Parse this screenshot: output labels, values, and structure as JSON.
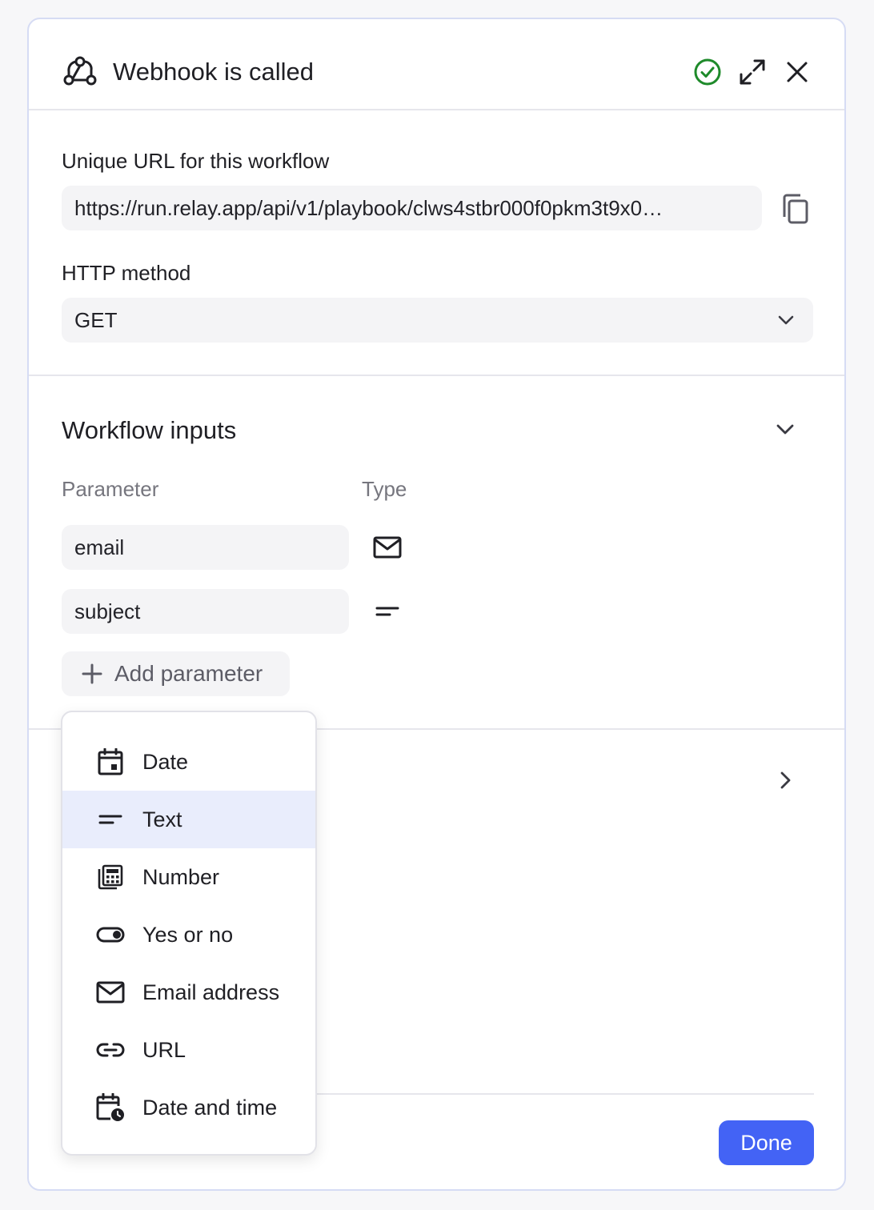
{
  "header": {
    "title": "Webhook is called",
    "icon": "webhook-icon",
    "status_icon": "check-circle-icon",
    "status_color": "#1e8a2a",
    "expand_icon": "expand-icon",
    "close_icon": "close-icon"
  },
  "url_section": {
    "label": "Unique URL for this workflow",
    "url_value": "https://run.relay.app/api/v1/playbook/clws4stbr000f0pkm3t9x0…",
    "copy_icon": "copy-icon"
  },
  "method_section": {
    "label": "HTTP method",
    "selected": "GET"
  },
  "inputs_section": {
    "title": "Workflow inputs",
    "columns": {
      "parameter": "Parameter",
      "type": "Type"
    },
    "params": [
      {
        "name": "email",
        "type_icon": "mail-icon"
      },
      {
        "name": "subject",
        "type_icon": "text-lines-icon"
      }
    ],
    "add_label": "Add parameter"
  },
  "type_menu": {
    "items": [
      {
        "label": "Date",
        "icon": "calendar-icon",
        "active": false
      },
      {
        "label": "Text",
        "icon": "text-lines-icon",
        "active": true
      },
      {
        "label": "Number",
        "icon": "calculator-icon",
        "active": false
      },
      {
        "label": "Yes or no",
        "icon": "toggle-icon",
        "active": false
      },
      {
        "label": "Email address",
        "icon": "mail-icon",
        "active": false
      },
      {
        "label": "URL",
        "icon": "link-icon",
        "active": false
      },
      {
        "label": "Date and time",
        "icon": "calendar-clock-icon",
        "active": false
      }
    ]
  },
  "footer": {
    "done_label": "Done",
    "done_color": "#4363f5"
  }
}
